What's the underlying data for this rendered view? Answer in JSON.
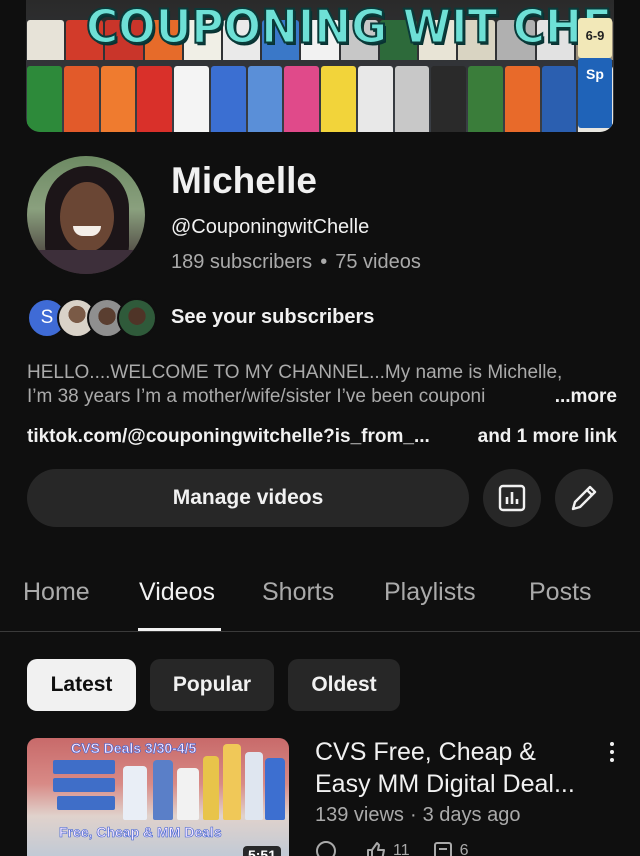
{
  "banner": {
    "title": "COUPONING WIT CHELLE",
    "badge_top": "6-9",
    "badge_bottom": "Sp"
  },
  "profile": {
    "name": "Michelle",
    "handle": "@CouponingwitChelle",
    "subscribers": "189 subscribers",
    "videos": "75 videos",
    "separator": "•"
  },
  "subscribers_row": {
    "first_initial": "S",
    "label": "See your subscribers"
  },
  "description": {
    "line1": "HELLO....WELCOME TO MY CHANNEL...My name is Michelle,",
    "line2": "I’m 38 years I’m a mother/wife/sister I’ve been couponi",
    "more": "...more"
  },
  "links": {
    "primary": "tiktok.com/@couponingwitchelle?is_from_...",
    "extra": "and 1 more link"
  },
  "actions": {
    "manage_videos": "Manage videos",
    "analytics_icon": "analytics-icon",
    "edit_icon": "pencil-icon"
  },
  "tabs": [
    "Home",
    "Videos",
    "Shorts",
    "Playlists",
    "Posts"
  ],
  "active_tab": "Videos",
  "chips": [
    "Latest",
    "Popular",
    "Oldest"
  ],
  "active_chip": "Latest",
  "video": {
    "thumb_text_top": "CVS Deals 3/30-4/5",
    "thumb_text_bottom": "Free, Cheap & MM Deals",
    "duration": "5:51",
    "title_line1": "CVS Free, Cheap &",
    "title_line2": "Easy MM Digital Deal...",
    "views": "139 views",
    "age": "3 days ago",
    "likes": "11",
    "comments": "6"
  },
  "colors": {
    "background": "#0f0f0f",
    "surface": "#272727",
    "text_primary": "#f1f1f1",
    "text_secondary": "#aaaaaa",
    "banner_title": "#6ee0d6"
  }
}
